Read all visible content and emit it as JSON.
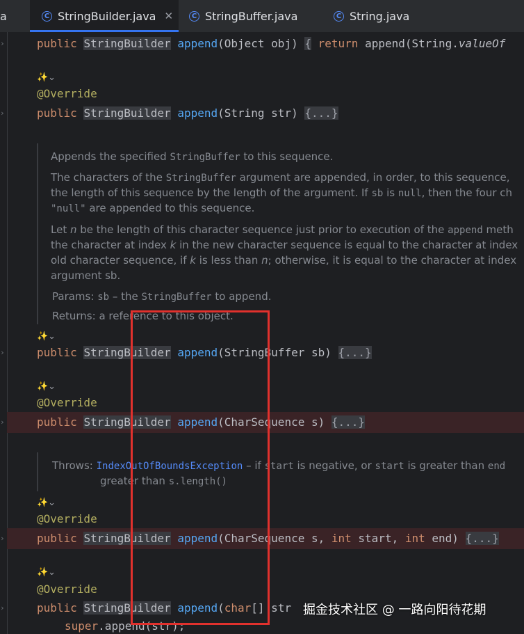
{
  "tabs": [
    {
      "label": "a"
    },
    {
      "label": "StringBuilder.java",
      "icon": "class-icon",
      "active": true
    },
    {
      "label": "StringBuffer.java",
      "icon": "class-icon"
    },
    {
      "label": "String.java",
      "icon": "class-icon"
    }
  ],
  "code": {
    "l1": {
      "kw": "public",
      "type": "StringBuilder",
      "fn": "append",
      "args": "(Object obj)",
      "fold": "{",
      "kw2": "return",
      "rest": "append(String.",
      "italic": "valueOf"
    },
    "ann": "@Override",
    "l2": {
      "kw": "public",
      "type": "StringBuilder",
      "fn": "append",
      "args": "(String str)",
      "fold": "{...}"
    },
    "l3": {
      "kw": "public",
      "type": "StringBuilder",
      "fn": "append",
      "args": "(StringBuffer sb)",
      "fold": "{...}"
    },
    "l4": {
      "kw": "public",
      "type": "StringBuilder",
      "fn": "append",
      "args": "(CharSequence s)",
      "fold": "{...}"
    },
    "l5": {
      "kw": "public",
      "type": "StringBuilder",
      "fn": "append",
      "args": "(CharSequence s, ",
      "int1": "int",
      "mid": " start, ",
      "int2": "int",
      "end": " end)",
      "fold": "{...}"
    },
    "l6": {
      "kw": "public",
      "type": "StringBuilder",
      "fn": "append",
      "args": "(",
      "char": "char",
      "rest": "[] str"
    },
    "l7": {
      "super": "super",
      "rest": ".append(str);"
    }
  },
  "doc1": {
    "p1a": "Appends the specified ",
    "p1b": "StringBuffer",
    "p1c": " to this sequence.",
    "p2a": "The characters of the ",
    "p2b": "StringBuffer",
    "p2c": " argument are appended, in order, to this sequence,",
    "p3a": "the length of this sequence by the length of the argument. If ",
    "p3b": "sb",
    "p3c": " is ",
    "p3d": "null",
    "p3e": ", then the four ch",
    "p4a": "\"null\"",
    "p4b": " are appended to this sequence.",
    "p5a": "Let ",
    "p5b": "n",
    "p5c": " be the length of this character sequence just prior to execution of the ",
    "p5d": "append",
    "p5e": " meth",
    "p6a": "the character at index ",
    "p6b": "k",
    "p6c": " in the new character sequence is equal to the character at index",
    "p7a": "old character sequence, if ",
    "p7b": "k",
    "p7c": " is less than ",
    "p7d": "n",
    "p7e": "; otherwise, it is equal to the character at index",
    "p8": "argument sb.",
    "params_label": "Params:",
    "params_code": "sb",
    "params_text1": " – the ",
    "params_code2": "StringBuffer",
    "params_text2": " to append.",
    "returns_label": "Returns:",
    "returns_text": "a reference to this object."
  },
  "doc2": {
    "label": "Throws:",
    "exc": "IndexOutOfBoundsException",
    "t1": " – if ",
    "c1": "start",
    "t2": " is negative, or ",
    "c2": "start",
    "t3": " is greater than ",
    "c3": "end",
    "l2a": "greater than ",
    "l2b": "s.length()"
  },
  "ai_glyph": "✨⌄",
  "watermark": "掘金技术社区 @ 一路向阳待花期"
}
